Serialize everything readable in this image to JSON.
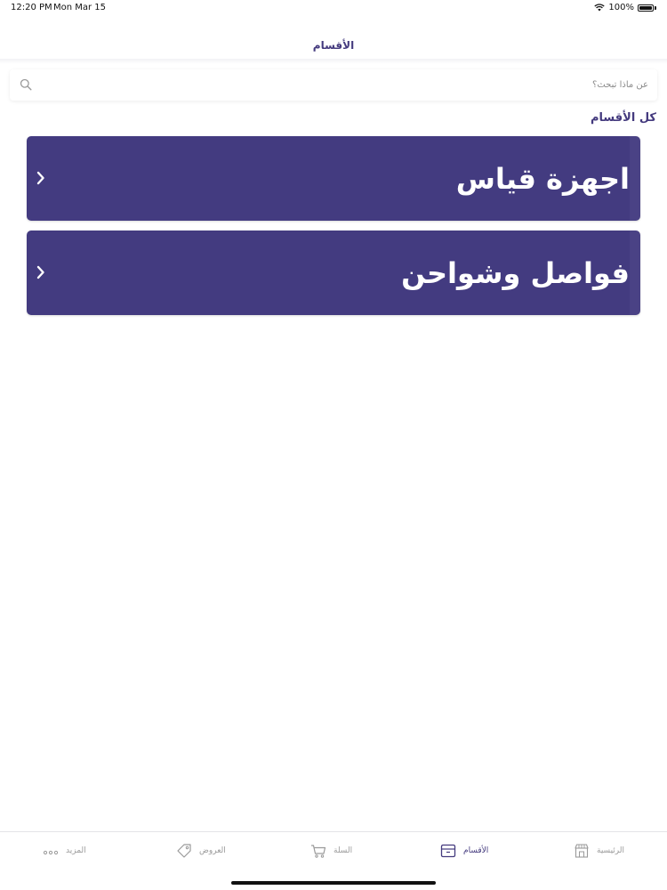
{
  "status": {
    "time": "12:20 PM",
    "date": "Mon Mar 15",
    "battery": "100%"
  },
  "nav": {
    "title": "الأقسام"
  },
  "search": {
    "placeholder": "عن ماذا تبحث؟"
  },
  "section": {
    "title": "كل الأقسام"
  },
  "categories": [
    {
      "label": "اجهزة قياس"
    },
    {
      "label": "فواصل وشواحن"
    }
  ],
  "tabs": {
    "more": "المزيد",
    "offers": "العروض",
    "cart": "السلة",
    "categories": "الأقسام",
    "home": "الرئيسية"
  },
  "colors": {
    "primary": "#433b80",
    "inactive": "#9a9a9a"
  }
}
